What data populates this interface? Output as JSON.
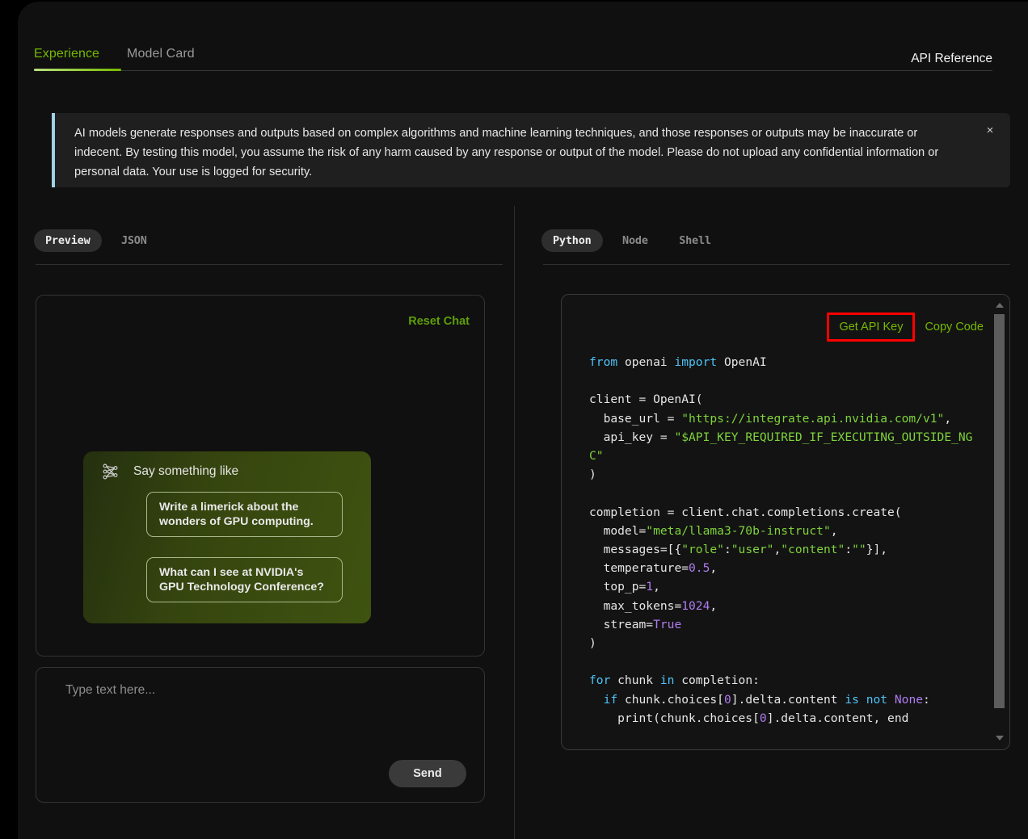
{
  "theme": {
    "accent_green": "#76b900",
    "link_green": "#5f9e09",
    "banner_accent": "#9fd2e8",
    "highlight_red": "#ff0000",
    "background": "#101010"
  },
  "header": {
    "tabs": [
      {
        "label": "Experience",
        "active": true
      },
      {
        "label": "Model Card",
        "active": false
      }
    ],
    "api_reference_label": "API Reference"
  },
  "banner": {
    "text": "AI models generate responses and outputs based on complex algorithms and machine learning techniques, and those responses or outputs may be inaccurate or indecent. By testing this model, you assume the risk of any harm caused by any response or output of the model. Please do not upload any confidential information or personal data. Your use is logged for security.",
    "close_icon": "close-icon",
    "close_glyph": "×"
  },
  "left_panel": {
    "tabs": [
      {
        "label": "Preview",
        "active": true
      },
      {
        "label": "JSON",
        "active": false
      }
    ],
    "reset_chat_label": "Reset Chat",
    "suggestions": {
      "icon": "neural-network-icon",
      "title": "Say something like",
      "items": [
        "Write a limerick about the wonders of GPU computing.",
        "What can I see at NVIDIA's GPU Technology Conference?"
      ]
    },
    "composer": {
      "placeholder": "Type text here...",
      "value": "",
      "send_label": "Send"
    }
  },
  "right_panel": {
    "tabs": [
      {
        "label": "Python",
        "active": true
      },
      {
        "label": "Node",
        "active": false
      },
      {
        "label": "Shell",
        "active": false
      }
    ],
    "actions": {
      "get_api_key_label": "Get API Key",
      "copy_code_label": "Copy Code",
      "highlighted": "get-api-key-button"
    },
    "code": {
      "language": "Python",
      "model": "meta/llama3-70b-instruct",
      "base_url": "https://integrate.api.nvidia.com/v1",
      "api_key": "$API_KEY_REQUIRED_IF_EXECUTING_OUTSIDE_NGC",
      "params": {
        "temperature": "0.5",
        "top_p": "1",
        "max_tokens": "1024",
        "stream": "True"
      },
      "lines": [
        "from openai import OpenAI",
        "",
        "client = OpenAI(",
        "  base_url = \"https://integrate.api.nvidia.com/v1\",",
        "  api_key = \"$API_KEY_REQUIRED_IF_EXECUTING_OUTSIDE_NGC\"",
        ")",
        "",
        "completion = client.chat.completions.create(",
        "  model=\"meta/llama3-70b-instruct\",",
        "  messages=[{\"role\":\"user\",\"content\":\"\"}],",
        "  temperature=0.5,",
        "  top_p=1,",
        "  max_tokens=1024,",
        "  stream=True",
        ")",
        "",
        "for chunk in completion:",
        "  if chunk.choices[0].delta.content is not None:",
        "    print(chunk.choices[0].delta.content, end"
      ]
    },
    "scrollbar": {
      "up_icon": "scroll-up-arrow-icon",
      "down_icon": "scroll-down-arrow-icon"
    }
  }
}
